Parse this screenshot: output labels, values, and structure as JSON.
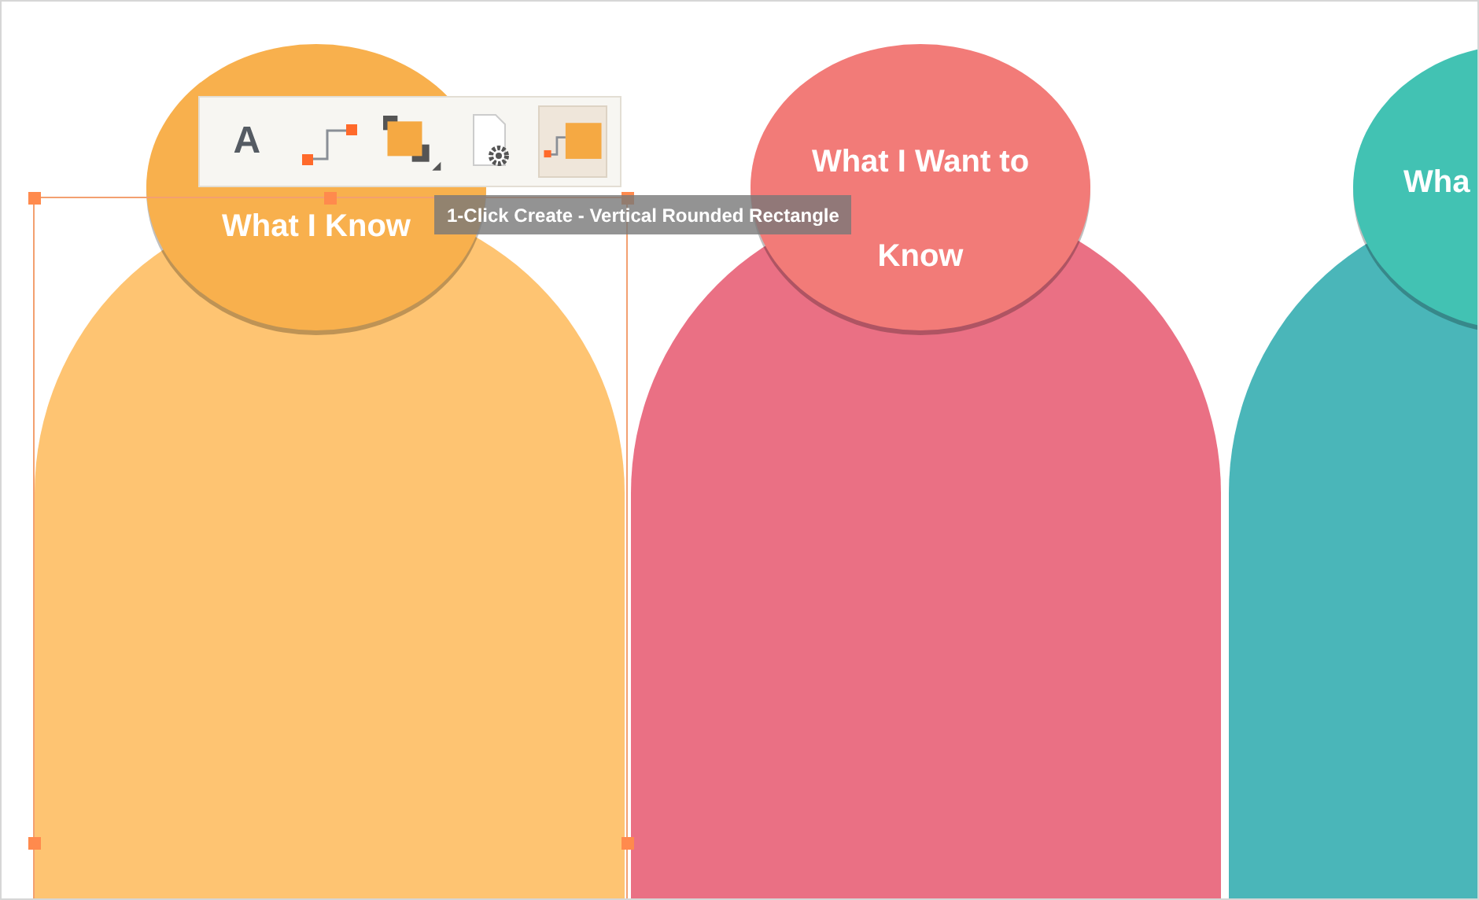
{
  "columns": [
    {
      "color": "#fec472",
      "header": {
        "color": "#f8b04d",
        "title_lines": [
          "What I Know"
        ]
      }
    },
    {
      "color": "#ea7084",
      "header": {
        "color": "#f27b78",
        "title_lines": [
          "What I Want to",
          "Know"
        ]
      }
    },
    {
      "color": "#4ab6b9",
      "header": {
        "color": "#42c2b3",
        "title_lines": [
          "Wha"
        ]
      }
    }
  ],
  "toolbar": {
    "items": [
      {
        "kind": "text",
        "label": "A",
        "selected": false
      },
      {
        "kind": "connector",
        "selected": false
      },
      {
        "kind": "arrange",
        "selected": false
      },
      {
        "kind": "page-settings",
        "selected": false
      },
      {
        "kind": "one-click",
        "selected": true
      }
    ]
  },
  "tooltip": "1-Click Create - Vertical Rounded Rectangle"
}
